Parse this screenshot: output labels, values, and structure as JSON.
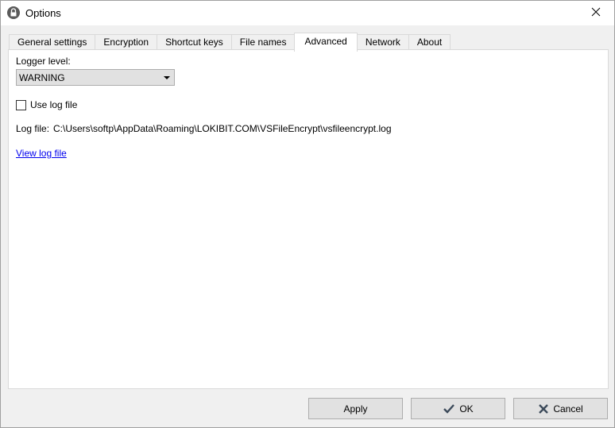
{
  "window": {
    "title": "Options"
  },
  "tabs": [
    {
      "label": "General settings"
    },
    {
      "label": "Encryption"
    },
    {
      "label": "Shortcut keys"
    },
    {
      "label": "File names"
    },
    {
      "label": "Advanced"
    },
    {
      "label": "Network"
    },
    {
      "label": "About"
    }
  ],
  "advanced": {
    "logger_label": "Logger level:",
    "logger_value": "WARNING",
    "use_log_label": "Use log file",
    "use_log_checked": false,
    "log_file_label": "Log file:",
    "log_file_path": "C:\\Users\\softp\\AppData\\Roaming\\LOKIBIT.COM\\VSFileEncrypt\\vsfileencrypt.log",
    "view_log_link": "View log file"
  },
  "buttons": {
    "apply": "Apply",
    "ok": "OK",
    "cancel": "Cancel"
  },
  "icons": {
    "app": "lock-icon",
    "close": "close-icon",
    "ok": "checkmark-icon",
    "cancel": "x-icon"
  }
}
